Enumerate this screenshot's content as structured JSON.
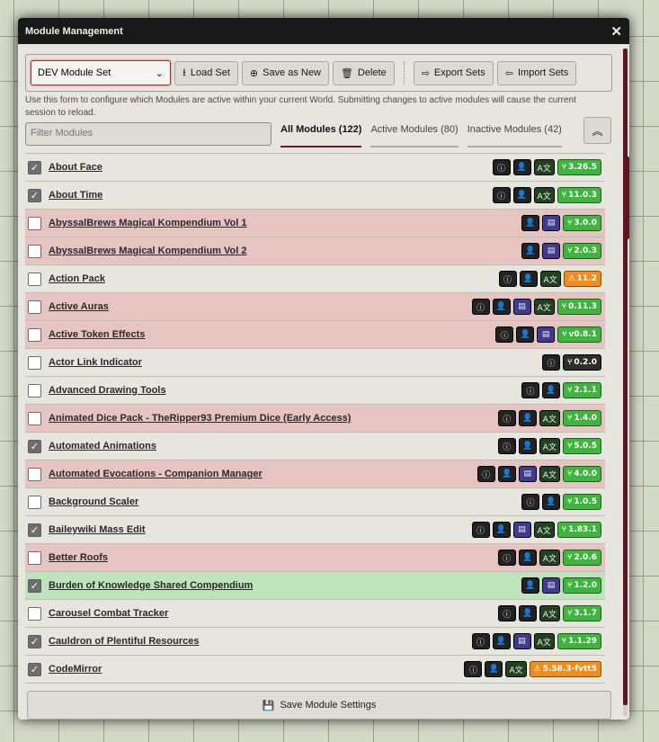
{
  "window": {
    "title": "Module Management",
    "close_label": "✕"
  },
  "toolbar": {
    "module_set": "DEV Module Set",
    "load_label": "Load Set",
    "save_new_label": "Save as New",
    "delete_label": "Delete",
    "export_label": "Export Sets",
    "import_label": "Import Sets"
  },
  "description": "Use this form to configure which Modules are active within your current World. Submitting changes to active modules will cause the current session to reload.",
  "filter": {
    "placeholder": "Filter Modules"
  },
  "tabs": [
    {
      "label": "All Modules (122)"
    },
    {
      "label": "Active Modules (80)"
    },
    {
      "label": "Inactive Modules (42)"
    }
  ],
  "colors": {
    "accent": "#5f1422",
    "inactive_row": "#e5aaaa",
    "active_row": "#aae4aa",
    "version_ok": "#3fb53f",
    "version_warn": "#ee8e1e"
  },
  "modules": [
    {
      "name": "About Face",
      "checked": true,
      "bg": "none",
      "tags": [
        "info",
        "author",
        "language"
      ],
      "version": "3.26.5",
      "vstyle": "green"
    },
    {
      "name": "About Time",
      "checked": true,
      "bg": "none",
      "tags": [
        "info",
        "author",
        "language"
      ],
      "version": "11.0.3",
      "vstyle": "green"
    },
    {
      "name": "AbyssalBrews Magical Kompendium Vol 1",
      "checked": false,
      "bg": "inactive",
      "tags": [
        "author",
        "compendium"
      ],
      "version": "3.0.0",
      "vstyle": "green"
    },
    {
      "name": "AbyssalBrews Magical Kompendium Vol 2",
      "checked": false,
      "bg": "inactive",
      "tags": [
        "author",
        "compendium"
      ],
      "version": "2.0.3",
      "vstyle": "green"
    },
    {
      "name": "Action Pack",
      "checked": false,
      "bg": "none",
      "tags": [
        "info",
        "author",
        "language"
      ],
      "version": "11.2",
      "vstyle": "orange"
    },
    {
      "name": "Active Auras",
      "checked": false,
      "bg": "inactive",
      "tags": [
        "info",
        "author",
        "compendium",
        "language"
      ],
      "version": "0.11.3",
      "vstyle": "green"
    },
    {
      "name": "Active Token Effects",
      "checked": false,
      "bg": "inactive",
      "tags": [
        "info",
        "author",
        "compendium"
      ],
      "version": "v0.8.1",
      "vstyle": "green"
    },
    {
      "name": "Actor Link Indicator",
      "checked": false,
      "bg": "none",
      "tags": [
        "info"
      ],
      "version": "0.2.0",
      "vstyle": "dark"
    },
    {
      "name": "Advanced Drawing Tools",
      "checked": false,
      "bg": "none",
      "tags": [
        "info",
        "author"
      ],
      "version": "2.1.1",
      "vstyle": "green"
    },
    {
      "name": "Animated Dice Pack - TheRipper93 Premium Dice (Early Access)",
      "checked": false,
      "bg": "inactive",
      "tags": [
        "info",
        "author",
        "language"
      ],
      "version": "1.4.0",
      "vstyle": "green"
    },
    {
      "name": "Automated Animations",
      "checked": true,
      "bg": "none",
      "tags": [
        "info",
        "author",
        "language"
      ],
      "version": "5.0.5",
      "vstyle": "green"
    },
    {
      "name": "Automated Evocations - Companion Manager",
      "checked": false,
      "bg": "inactive",
      "tags": [
        "info",
        "author",
        "compendium",
        "language"
      ],
      "version": "4.0.0",
      "vstyle": "green"
    },
    {
      "name": "Background Scaler",
      "checked": false,
      "bg": "none",
      "tags": [
        "info",
        "author"
      ],
      "version": "1.0.5",
      "vstyle": "green"
    },
    {
      "name": "Baileywiki Mass Edit",
      "checked": true,
      "bg": "none",
      "tags": [
        "info",
        "author",
        "compendium",
        "language"
      ],
      "version": "1.83.1",
      "vstyle": "green"
    },
    {
      "name": "Better Roofs",
      "checked": false,
      "bg": "inactive",
      "tags": [
        "info",
        "author",
        "language"
      ],
      "version": "2.0.6",
      "vstyle": "green"
    },
    {
      "name": "Burden of Knowledge Shared Compendium",
      "checked": true,
      "bg": "active",
      "tags": [
        "author",
        "compendium"
      ],
      "version": "1.2.0",
      "vstyle": "green"
    },
    {
      "name": "Carousel Combat Tracker",
      "checked": false,
      "bg": "none",
      "tags": [
        "info",
        "author",
        "language"
      ],
      "version": "3.1.7",
      "vstyle": "green"
    },
    {
      "name": "Cauldron of Plentiful Resources",
      "checked": true,
      "bg": "none",
      "tags": [
        "info",
        "author",
        "compendium",
        "language"
      ],
      "version": "1.1.29",
      "vstyle": "green"
    },
    {
      "name": "CodeMirror",
      "checked": true,
      "bg": "none",
      "tags": [
        "info",
        "author",
        "language"
      ],
      "version": "5.58.3-fvtt5",
      "vstyle": "orange"
    }
  ],
  "footer": {
    "save_label": "Save Module Settings"
  }
}
